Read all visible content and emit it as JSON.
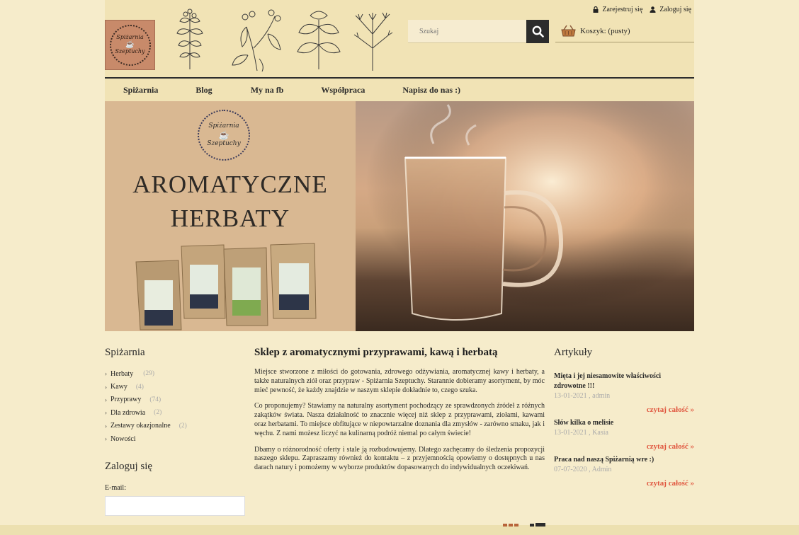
{
  "header": {
    "logo_line1": "Spiżarnia",
    "logo_line2": "Szeptuchy",
    "register_label": "Zarejestruj się",
    "login_label": "Zaloguj się"
  },
  "search": {
    "placeholder": "Szukaj"
  },
  "cart": {
    "label": "Koszyk: (pusty)"
  },
  "nav": {
    "items": [
      "Spiżarnia",
      "Blog",
      "My na fb",
      "Współpraca",
      "Napisz do nas :)"
    ]
  },
  "banner": {
    "logo_line1": "Spiżarnia",
    "logo_line2": "Szeptuchy",
    "title_line1": "AROMATYCZNE",
    "title_line2": "HERBATY"
  },
  "categories": {
    "title": "Spiżarnia",
    "items": [
      {
        "label": "Herbaty",
        "count": "(29)"
      },
      {
        "label": "Kawy",
        "count": "(4)"
      },
      {
        "label": "Przyprawy",
        "count": "(74)"
      },
      {
        "label": "Dla zdrowia",
        "count": "(2)"
      },
      {
        "label": "Zestawy okazjonalne",
        "count": "(2)"
      },
      {
        "label": "Nowości",
        "count": ""
      }
    ]
  },
  "login": {
    "title": "Zaloguj się",
    "email_label": "E-mail:"
  },
  "main": {
    "title": "Sklep z aromatycznymi przyprawami, kawą i herbatą",
    "paragraphs": [
      "Miejsce stworzone z miłości do gotowania, zdrowego odżywiania, aromatycznej kawy i herbaty, a także naturalnych ziół oraz przypraw - Spiżarnia Szeptuchy. Starannie dobieramy asortyment, by móc mieć pewność, że każdy znajdzie w naszym sklepie dokładnie to, czego szuka.",
      "Co proponujemy? Stawiamy na naturalny asortyment pochodzący ze sprawdzonych źródeł z różnych zakątków świata. Nasza działalność to znacznie więcej niż sklep z przyprawami, ziołami, kawami oraz herbatami. To miejsce obfitujące w niepowtarzalne doznania dla zmysłów - zarówno smaku, jak i węchu. Z nami możesz liczyć na kulinarną podróż niemal po całym świecie!",
      "Dbamy o różnorodność oferty i stale ją rozbudowujemy. Dlatego zachęcamy do śledzenia propozycji naszego sklepu. Zapraszamy również do kontaktu – z przyjemnością opowiemy o dostępnych u nas darach natury i pomożemy w wyborze produktów dopasowanych do indywidualnych oczekiwań."
    ]
  },
  "articles": {
    "title": "Artykuły",
    "more_label": "czytaj całość »",
    "items": [
      {
        "title": "Mięta i jej niesamowite właściwości zdrowotne !!!",
        "meta": "13-01-2021 , admin"
      },
      {
        "title": "Słów kilka o melisie",
        "meta": "13-01-2021 , Kasia"
      },
      {
        "title": "Praca nad naszą Spiżarnią wre :)",
        "meta": "07-07-2020 , Admin"
      }
    ]
  },
  "colors": {
    "accent": "#e0553e",
    "background": "#f6eccb",
    "header": "#f1e3b5",
    "dark": "#2c2c2c"
  },
  "icons": [
    "lock-icon",
    "user-icon",
    "search-icon",
    "basket-icon",
    "chevron-right-icon"
  ]
}
